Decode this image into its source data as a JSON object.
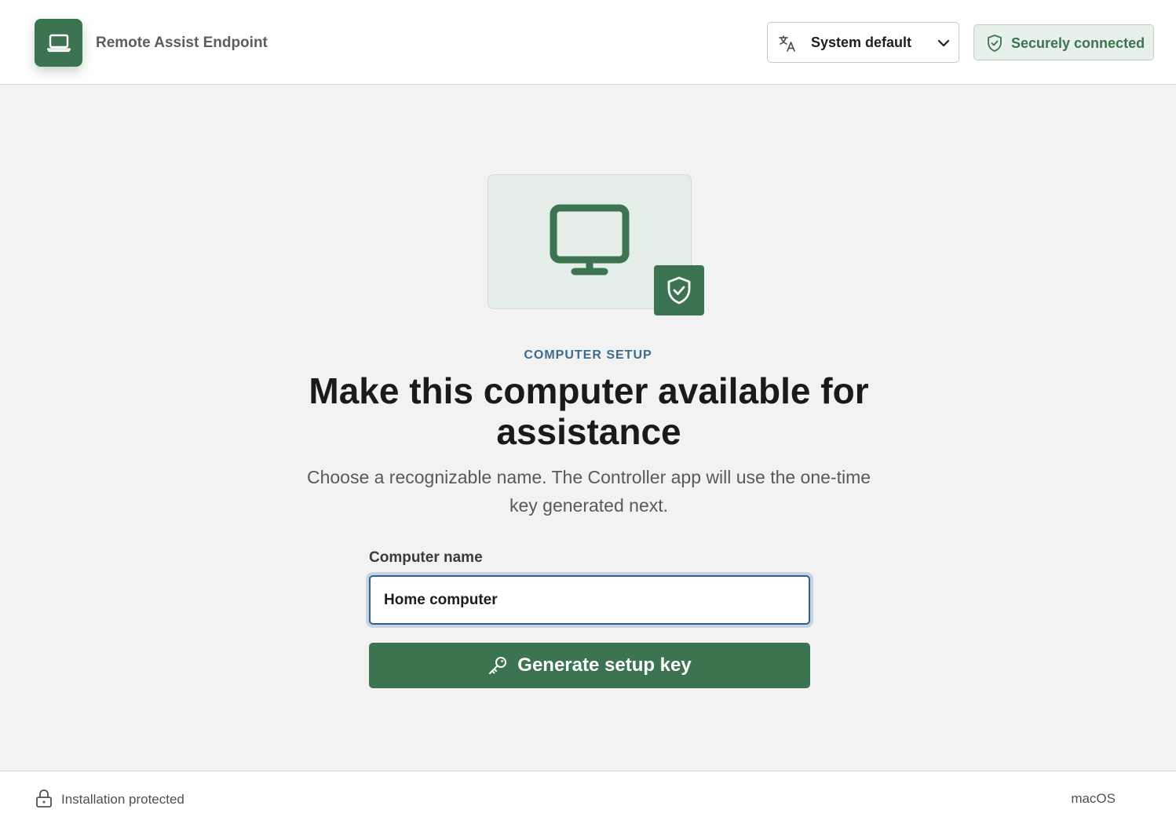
{
  "header": {
    "app_title": "Remote Assist Endpoint",
    "logo_icon": "laptop-icon",
    "language": {
      "icon": "translate-icon",
      "selected": "System default",
      "chevron_icon": "chevron-down-icon"
    },
    "status": {
      "icon": "shield-check-icon",
      "label": "Securely connected"
    }
  },
  "hero": {
    "monitor_icon": "monitor-icon",
    "badge_icon": "shield-check-icon"
  },
  "main": {
    "eyebrow": "COMPUTER SETUP",
    "title": "Make this computer available for assistance",
    "subtitle": "Choose a recognizable name. The Controller app will use the one-time key generated next.",
    "field_label": "Computer name",
    "input_value": "Home computer",
    "button_label": "Generate setup key",
    "button_icon": "key-icon"
  },
  "footer": {
    "lock_icon": "lock-icon",
    "protection_label": "Installation protected",
    "os_label": "macOS"
  },
  "colors": {
    "brand_green": "#3c7350",
    "eyebrow_blue": "#3b6c8f",
    "focus_ring": "#c6d3e2",
    "background": "#f2f2f2"
  }
}
